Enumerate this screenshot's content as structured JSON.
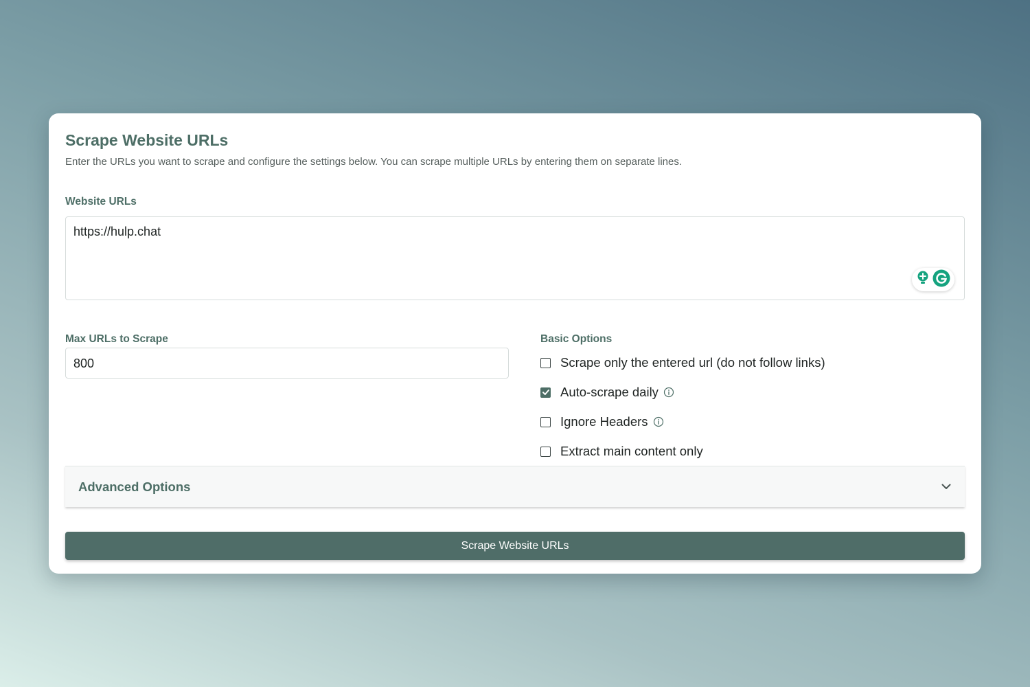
{
  "form": {
    "title": "Scrape Website URLs",
    "description": "Enter the URLs you want to scrape and configure the settings below. You can scrape multiple URLs by entering them on separate lines.",
    "urls_label": "Website URLs",
    "urls_value": "https://hulp.chat",
    "max_urls_label": "Max URLs to Scrape",
    "max_urls_value": "800",
    "basic_options_label": "Basic Options",
    "options": [
      {
        "label": "Scrape only the entered url (do not follow links)",
        "checked": false,
        "has_info": false
      },
      {
        "label": "Auto-scrape daily",
        "checked": true,
        "has_info": true
      },
      {
        "label": "Ignore Headers",
        "checked": false,
        "has_info": true
      },
      {
        "label": "Extract main content only",
        "checked": false,
        "has_info": false
      }
    ],
    "advanced_options_label": "Advanced Options",
    "submit_label": "Scrape Website URLs"
  },
  "icons": {
    "info": "info-circle-icon",
    "chevron": "chevron-down-icon",
    "grammarly": "grammarly-icon",
    "suggestion": "lightbulb-icon"
  },
  "colors": {
    "accent": "#4d6e66",
    "button": "#4f6d68",
    "grammarly": "#15a37f"
  }
}
